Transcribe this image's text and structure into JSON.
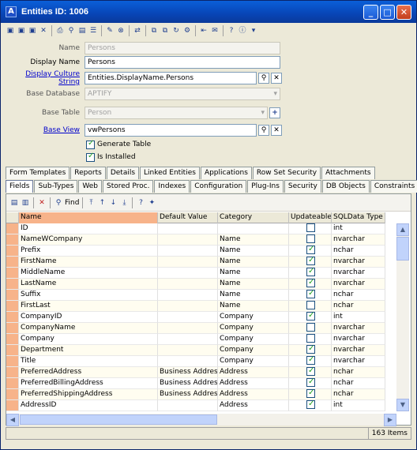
{
  "window": {
    "title": "Entities ID: 1006"
  },
  "form": {
    "name": {
      "label": "Name",
      "value": "Persons"
    },
    "display_name": {
      "label": "Display Name",
      "value": "Persons"
    },
    "display_culture": {
      "label": "Display Culture String",
      "value": "Entities.DisplayName.Persons"
    },
    "base_database": {
      "label": "Base Database",
      "value": "APTIFY"
    },
    "base_table": {
      "label": "Base Table",
      "value": "Person"
    },
    "base_view": {
      "label": "Base View",
      "value": "vwPersons"
    },
    "generate_table": {
      "label": "Generate Table",
      "checked": true
    },
    "is_installed": {
      "label": "Is Installed",
      "checked": true
    }
  },
  "tabs_row1": [
    "Form Templates",
    "Reports",
    "Details",
    "Linked Entities",
    "Applications",
    "Row Set Security",
    "Attachments"
  ],
  "tabs_row2": [
    "Fields",
    "Sub-Types",
    "Web",
    "Stored Proc.",
    "Indexes",
    "Configuration",
    "Plug-Ins",
    "Security",
    "DB Objects",
    "Constraints"
  ],
  "grid_toolbar": {
    "find_label": "Find"
  },
  "columns": [
    "Name",
    "Default Value",
    "Category",
    "Updateable",
    "SQLData Type"
  ],
  "rows": [
    {
      "name": "ID",
      "default": "",
      "category": "",
      "updateable": false,
      "type": "int"
    },
    {
      "name": "NameWCompany",
      "default": "",
      "category": "Name",
      "updateable": false,
      "type": "nvarchar"
    },
    {
      "name": "Prefix",
      "default": "",
      "category": "Name",
      "updateable": true,
      "type": "nchar"
    },
    {
      "name": "FirstName",
      "default": "",
      "category": "Name",
      "updateable": true,
      "type": "nvarchar"
    },
    {
      "name": "MiddleName",
      "default": "",
      "category": "Name",
      "updateable": true,
      "type": "nvarchar"
    },
    {
      "name": "LastName",
      "default": "",
      "category": "Name",
      "updateable": true,
      "type": "nvarchar"
    },
    {
      "name": "Suffix",
      "default": "",
      "category": "Name",
      "updateable": true,
      "type": "nchar"
    },
    {
      "name": "FirstLast",
      "default": "",
      "category": "Name",
      "updateable": false,
      "type": "nchar"
    },
    {
      "name": "CompanyID",
      "default": "",
      "category": "Company",
      "updateable": true,
      "type": "int"
    },
    {
      "name": "CompanyName",
      "default": "",
      "category": "Company",
      "updateable": false,
      "type": "nvarchar"
    },
    {
      "name": "Company",
      "default": "",
      "category": "Company",
      "updateable": false,
      "type": "nvarchar"
    },
    {
      "name": "Department",
      "default": "",
      "category": "Company",
      "updateable": true,
      "type": "nvarchar"
    },
    {
      "name": "Title",
      "default": "",
      "category": "Company",
      "updateable": true,
      "type": "nvarchar"
    },
    {
      "name": "PreferredAddress",
      "default": "Business Address",
      "category": "Address",
      "updateable": true,
      "type": "nchar"
    },
    {
      "name": "PreferredBillingAddress",
      "default": "Business Address",
      "category": "Address",
      "updateable": true,
      "type": "nchar"
    },
    {
      "name": "PreferredShippingAddress",
      "default": "Business Address",
      "category": "Address",
      "updateable": true,
      "type": "nchar"
    },
    {
      "name": "AddressID",
      "default": "",
      "category": "Address",
      "updateable": true,
      "type": "int"
    }
  ],
  "status": {
    "count": "163 Items"
  }
}
